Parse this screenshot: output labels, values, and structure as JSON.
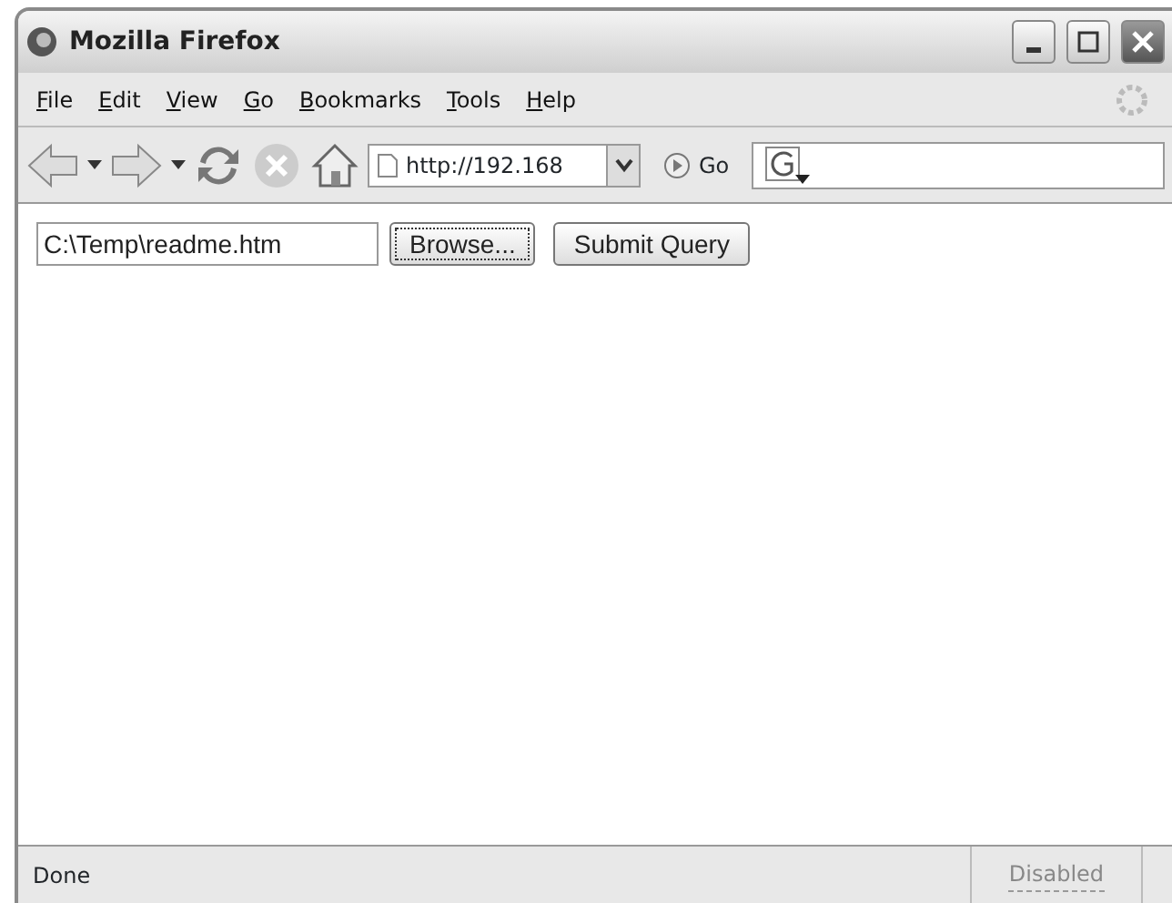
{
  "window": {
    "title": "Mozilla Firefox"
  },
  "menu": [
    "File",
    "Edit",
    "View",
    "Go",
    "Bookmarks",
    "Tools",
    "Help"
  ],
  "toolbar": {
    "url": "http://192.168",
    "go_label": "Go"
  },
  "form": {
    "file_value": "C:\\Temp\\readme.htm",
    "buttons": [
      {
        "label": "Browse...",
        "focused": true
      },
      {
        "label": "Submit Query",
        "focused": false
      }
    ]
  },
  "status_bar": {
    "text": "Done",
    "indicator": "Disabled"
  }
}
